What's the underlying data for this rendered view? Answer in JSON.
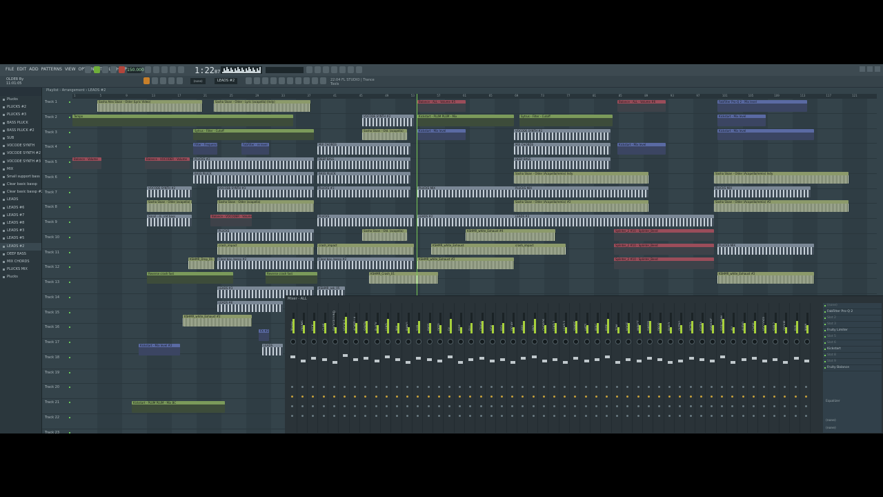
{
  "menu": [
    "FILE",
    "EDIT",
    "ADD",
    "PATTERNS",
    "VIEW",
    "OPTIONS",
    "TOOLS",
    "HELP"
  ],
  "transport": {
    "tempo": "150.000",
    "time": "1:22",
    "time_frac": "87"
  },
  "song": {
    "name": "OLDER By",
    "position": "11:01:05"
  },
  "pattern_selector": "LEADS #2",
  "hint": {
    "line1": "22:04  FL STUDIO | Trance",
    "line2": "Tools"
  },
  "playlist_title": "Playlist - Arrangement › LEADS #2",
  "browser_items": [
    "Plucks",
    "PLUCKS #2",
    "PLUCKS #3",
    "BASS PLUCK",
    "BASS PLUCK #2",
    "SUB",
    "VOCODE SYNTH",
    "VOCODE SYNTH #2",
    "VOCODE SYNTH #3",
    "MIX",
    "Small support bass",
    "Clear basic bassp",
    "Clear basic bassp #2",
    "LEADS",
    "LEADS #6",
    "LEADS #7",
    "LEADS #8",
    "LEADS #3",
    "LEADS #5",
    "LEADS #2",
    "DEEP BASS",
    "MIX CHORDS",
    "PLUCKS MIX",
    "Plucks"
  ],
  "browser_selected": 19,
  "ruler": [
    "1",
    "5",
    "9",
    "13",
    "17",
    "21",
    "25",
    "29",
    "33",
    "37",
    "41",
    "45",
    "49",
    "53",
    "57",
    "61",
    "65",
    "69",
    "73",
    "77",
    "81",
    "85",
    "89",
    "93",
    "97",
    "101",
    "105",
    "109",
    "113",
    "117",
    "121"
  ],
  "tracks": [
    "Track 1",
    "Track 2",
    "Track 3",
    "Track 4",
    "Track 5",
    "Track 6",
    "Track 7",
    "Track 8",
    "Track 9",
    "Track 10",
    "Track 11",
    "Track 12",
    "Track 13",
    "Track 14",
    "Track 15",
    "Track 16",
    "Track 17",
    "Track 18",
    "Track 19",
    "Track 20",
    "Track 21",
    "Track 22",
    "Track 23"
  ],
  "clips": [
    {
      "t": 0,
      "s": 36,
      "l": 152,
      "type": "audio",
      "label": "Sasha Alex Sloan - Older (Lyric Video)"
    },
    {
      "t": 0,
      "s": 205,
      "l": 140,
      "type": "audio",
      "label": "Sasha Sloan - Older - Lyric (acapella) (Indy)"
    },
    {
      "t": 0,
      "s": 500,
      "l": 70,
      "type": "auto",
      "label": "Balance - ALL - Volume #5"
    },
    {
      "t": 0,
      "s": 790,
      "l": 70,
      "type": "auto",
      "label": "Balance - ALL - Volume #6"
    },
    {
      "t": 0,
      "s": 935,
      "l": 130,
      "type": "blue",
      "label": "FabFilter Pro-Q 2 - Mix level"
    },
    {
      "t": 1,
      "s": 0,
      "l": 320,
      "type": "green",
      "label": "Tempo"
    },
    {
      "t": 1,
      "s": 420,
      "l": 75,
      "type": "note",
      "label": "VOCODE SYNTH #2"
    },
    {
      "t": 1,
      "s": 500,
      "l": 140,
      "type": "green",
      "label": "Kickstart - PLUM PLUM - Mix"
    },
    {
      "t": 1,
      "s": 648,
      "l": 135,
      "type": "green",
      "label": "Sytrus - Filter - Cutoff"
    },
    {
      "t": 1,
      "s": 935,
      "l": 70,
      "type": "blue",
      "label": "Kickstart - Mix level"
    },
    {
      "t": 2,
      "s": 175,
      "l": 175,
      "type": "green",
      "label": "Sytrus - Filter - Cutoff"
    },
    {
      "t": 2,
      "s": 420,
      "l": 65,
      "type": "audio",
      "label": "Sasha Sloan - Old. (acapella)"
    },
    {
      "t": 2,
      "s": 500,
      "l": 70,
      "type": "blue",
      "label": "Kickstart - Mix level"
    },
    {
      "t": 2,
      "s": 640,
      "l": 140,
      "type": "note",
      "label": "VOCODE SYNTH #2"
    },
    {
      "t": 2,
      "s": 935,
      "l": 140,
      "type": "blue",
      "label": "Kickstart - Mix level"
    },
    {
      "t": 3,
      "s": 175,
      "l": 35,
      "type": "blue",
      "label": "Filter - Frequency"
    },
    {
      "t": 3,
      "s": 245,
      "l": 40,
      "type": "blue",
      "label": "FabFilter - re level"
    },
    {
      "t": 3,
      "s": 355,
      "l": 135,
      "type": "note",
      "label": "MIX CHORDS"
    },
    {
      "t": 3,
      "s": 640,
      "l": 140,
      "type": "note",
      "label": "MIX CHORDS"
    },
    {
      "t": 3,
      "s": 790,
      "l": 70,
      "type": "blue",
      "label": "Kickstart - Mix level"
    },
    {
      "t": 4,
      "s": 0,
      "l": 42,
      "type": "auto",
      "label": "Balance - Volume"
    },
    {
      "t": 4,
      "s": 105,
      "l": 65,
      "type": "auto",
      "label": "Balance - VOCODER - Volume"
    },
    {
      "t": 4,
      "s": 175,
      "l": 175,
      "type": "note",
      "label": "PLUCKS #2"
    },
    {
      "t": 4,
      "s": 355,
      "l": 135,
      "type": "note",
      "label": "DEEP BASS"
    },
    {
      "t": 4,
      "s": 640,
      "l": 140,
      "type": "note",
      "label": "DEEP BASS"
    },
    {
      "t": 5,
      "s": 175,
      "l": 175,
      "type": "note",
      "label": "BASS PLUCK"
    },
    {
      "t": 5,
      "s": 355,
      "l": 135,
      "type": "note",
      "label": "BASS PLUCK"
    },
    {
      "t": 5,
      "s": 640,
      "l": 195,
      "type": "audio",
      "label": "Sasha Sloan - Older (Acapella/remix) Indy"
    },
    {
      "t": 5,
      "s": 930,
      "l": 195,
      "type": "audio",
      "label": "Sasha Sloan - Older (Acapella/remix) Indy"
    },
    {
      "t": 6,
      "s": 108,
      "l": 65,
      "type": "note",
      "label": "VOCODE SYNTH #2"
    },
    {
      "t": 6,
      "s": 210,
      "l": 140,
      "type": "note",
      "label": "VOCODE SYNTH #3"
    },
    {
      "t": 6,
      "s": 355,
      "l": 135,
      "type": "note",
      "label": "PLUCKS #3"
    },
    {
      "t": 6,
      "s": 500,
      "l": 140,
      "type": "note",
      "label": "PLUCKS MIX"
    },
    {
      "t": 6,
      "s": 640,
      "l": 195,
      "type": "note",
      "label": "PLUCKS MIX"
    },
    {
      "t": 6,
      "s": 930,
      "l": 140,
      "type": "note",
      "label": "PLUCKS MIX"
    },
    {
      "t": 7,
      "s": 108,
      "l": 65,
      "type": "audio",
      "label": "Sasha Sloan - Older (acapella) #2"
    },
    {
      "t": 7,
      "s": 210,
      "l": 140,
      "type": "audio",
      "label": "Sasha Sloan - Older (acapella)"
    },
    {
      "t": 7,
      "s": 640,
      "l": 195,
      "type": "audio",
      "label": "Sasha Sloan - Older (Acapella/remix) #2"
    },
    {
      "t": 7,
      "s": 930,
      "l": 195,
      "type": "audio",
      "label": "Sasha Sloan - Older (Acapella/remix) #2"
    },
    {
      "t": 8,
      "s": 108,
      "l": 65,
      "type": "note",
      "label": "Small - ck..imt bass"
    },
    {
      "t": 8,
      "s": 200,
      "l": 60,
      "type": "auto",
      "label": "Balance - VOCODER - Volume"
    },
    {
      "t": 8,
      "s": 355,
      "l": 140,
      "type": "note",
      "label": "PLUCKS"
    },
    {
      "t": 8,
      "s": 500,
      "l": 140,
      "type": "note",
      "label": "LEADS #2"
    },
    {
      "t": 8,
      "s": 640,
      "l": 290,
      "type": "note",
      "label": "LEADS #2"
    },
    {
      "t": 9,
      "s": 210,
      "l": 140,
      "type": "note",
      "label": "PLUCKS"
    },
    {
      "t": 9,
      "s": 420,
      "l": 65,
      "type": "audio",
      "label": "Sasha Sloan - Old. (acapella)"
    },
    {
      "t": 9,
      "s": 570,
      "l": 130,
      "type": "audio",
      "label": "KSHMR_white_Exhaust #4"
    },
    {
      "t": 9,
      "s": 785,
      "l": 145,
      "type": "auto",
      "label": "Splinter_2 #10 - Splinter_Bend"
    },
    {
      "t": 10,
      "s": 210,
      "l": 140,
      "type": "audio",
      "label": "crash_impact"
    },
    {
      "t": 10,
      "s": 355,
      "l": 140,
      "type": "audio",
      "label": "crash_impact"
    },
    {
      "t": 10,
      "s": 520,
      "l": 140,
      "type": "audio",
      "label": "KSHMR_white_Exhaust"
    },
    {
      "t": 10,
      "s": 640,
      "l": 75,
      "type": "audio",
      "label": "crash_impact"
    },
    {
      "t": 10,
      "s": 785,
      "l": 145,
      "type": "auto",
      "label": "Splinter_2 #10 - Splinter_Bend"
    },
    {
      "t": 10,
      "s": 935,
      "l": 140,
      "type": "note",
      "label": "PLUCKS MIX"
    },
    {
      "t": 11,
      "s": 168,
      "l": 38,
      "type": "audio",
      "label": "KSHMR_Drop_01"
    },
    {
      "t": 11,
      "s": 210,
      "l": 140,
      "type": "note",
      "label": "Clear bas..bassp #2"
    },
    {
      "t": 11,
      "s": 355,
      "l": 140,
      "type": "note",
      "label": "Clear bas..bassp #2"
    },
    {
      "t": 11,
      "s": 500,
      "l": 140,
      "type": "audio",
      "label": "KSHMR_white_Exhaust #2"
    },
    {
      "t": 11,
      "s": 785,
      "l": 145,
      "type": "auto",
      "label": "Splinter_2 #10 - Splinter_Bend"
    },
    {
      "t": 12,
      "s": 108,
      "l": 125,
      "type": "green",
      "label": "Reverse crash fast"
    },
    {
      "t": 12,
      "s": 280,
      "l": 75,
      "type": "green",
      "label": "Reverse crash fast"
    },
    {
      "t": 12,
      "s": 430,
      "l": 100,
      "type": "audio",
      "label": "KSHMR_Crash_01"
    },
    {
      "t": 12,
      "s": 935,
      "l": 140,
      "type": "audio",
      "label": "KSHMR_white_Exhaust #2"
    },
    {
      "t": 13,
      "s": 210,
      "l": 140,
      "type": "note",
      "label": "LEADS #3"
    },
    {
      "t": 13,
      "s": 355,
      "l": 40,
      "type": "note",
      "label": "KSHMR_ask_05"
    },
    {
      "t": 14,
      "s": 210,
      "l": 95,
      "type": "note",
      "label": "LEADS #6"
    },
    {
      "t": 15,
      "s": 160,
      "l": 100,
      "type": "audio",
      "label": "KSHMR_white_Exhaust #2"
    },
    {
      "t": 16,
      "s": 270,
      "l": 15,
      "type": "blue",
      "label": "FX #3"
    },
    {
      "t": 17,
      "s": 96,
      "l": 60,
      "type": "blue",
      "label": "Kickstart - Mix level #2"
    },
    {
      "t": 17,
      "s": 275,
      "l": 30,
      "type": "note",
      "label": "LEADS"
    },
    {
      "t": 21,
      "s": 86,
      "l": 135,
      "type": "green",
      "label": "Kickstart - PLUM PLUM - Mix BC"
    }
  ],
  "mixer": {
    "title": "Mixer - ALL",
    "insert_label": "Mixer - ALL",
    "channels": [
      "Master",
      "DRUMS",
      "KICK",
      "CLAP",
      "BACKGROUND",
      "VOCALS",
      "ACAPELLA",
      "SYNTH",
      "PLUCK",
      "LEAD",
      "MIX",
      "PIANO",
      "SUB",
      "BASS",
      "DEEP",
      "FX",
      "RISE",
      "FILL",
      "CRASH",
      "VOX",
      "REV",
      "DELAY",
      "ARP",
      "PAD",
      "CHORDS",
      "LEAD 2",
      "LEAD 3",
      "SNARE",
      "HATS",
      "PERC",
      "RIDE",
      "TOM",
      "NOISE",
      "IMPACT",
      "SWEEP",
      "DROP",
      "BUILD",
      "OUTRO",
      "INTRO",
      "EXTRA",
      "AMBIENT",
      "SIDECHAIN",
      "ALL",
      "AUDIO",
      "CHOP",
      "VOCODER",
      "SUB 2",
      "GROUP",
      "BUS",
      "MAIN"
    ],
    "levels": [
      0.7,
      0.4,
      0.6,
      0.5,
      0.3,
      0.8,
      0.5,
      0.6,
      0.4,
      0.7,
      0.5,
      0.3,
      0.6,
      0.5,
      0.4,
      0.7,
      0.3,
      0.5,
      0.6,
      0.4,
      0.5,
      0.3,
      0.6,
      0.7,
      0.4,
      0.5,
      0.3,
      0.6,
      0.4,
      0.5,
      0.7,
      0.3,
      0.5,
      0.4,
      0.6,
      0.5,
      0.3,
      0.4,
      0.6,
      0.5,
      0.4,
      0.7,
      0.3,
      0.5,
      0.6,
      0.4,
      0.5,
      0.3,
      0.6,
      0.4
    ],
    "fx_slots": [
      {
        "name": "(none)",
        "empty": true
      },
      {
        "name": "FabFilter Pro-Q 2",
        "empty": false
      },
      {
        "name": "Slot 2",
        "empty": true
      },
      {
        "name": "Slot 3",
        "empty": true
      },
      {
        "name": "Fruity Limiter",
        "empty": false
      },
      {
        "name": "Slot 5",
        "empty": true
      },
      {
        "name": "Slot 6",
        "empty": true
      },
      {
        "name": "Kickstart",
        "empty": false
      },
      {
        "name": "Slot 8",
        "empty": true
      },
      {
        "name": "Slot 9",
        "empty": true
      },
      {
        "name": "Fruity Balance",
        "empty": false
      }
    ],
    "equalizer_label": "Equalizer",
    "out_labels": [
      "(none)",
      "(none)"
    ]
  }
}
